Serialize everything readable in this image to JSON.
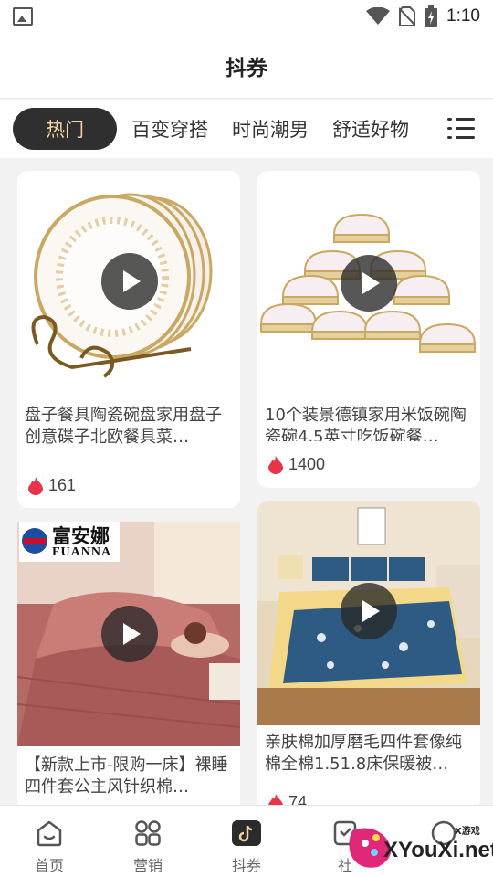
{
  "status_bar": {
    "time": "1:10",
    "icons": [
      "gallery-icon",
      "wifi-icon",
      "no-sim-icon",
      "battery-charging-icon"
    ]
  },
  "header": {
    "title": "抖券"
  },
  "tabs": {
    "items": [
      {
        "label": "热门",
        "active": true
      },
      {
        "label": "百变穿搭",
        "active": false
      },
      {
        "label": "时尚潮男",
        "active": false
      },
      {
        "label": "舒适好物",
        "active": false
      }
    ],
    "menu_icon": "list-menu-icon"
  },
  "feed": {
    "cards": [
      {
        "title": "盘子餐具陶瓷碗盘家用盘子创意碟子北欧餐具菜…",
        "likes": "161"
      },
      {
        "title": "10个装景德镇家用米饭碗陶瓷碗4.5英寸吃饭碗餐…",
        "likes": "1400"
      },
      {
        "title": "【新款上市-限购一床】裸睡四件套公主风针织棉…",
        "likes": "",
        "brand_text": "富安娜",
        "brand_en": "FUANNA"
      },
      {
        "title": "亲肤棉加厚磨毛四件套像纯棉全棉1.51.8床保暖被…",
        "likes": "74"
      }
    ]
  },
  "bottom_nav": {
    "items": [
      {
        "label": "首页",
        "icon": "home-icon",
        "active": false
      },
      {
        "label": "营销",
        "icon": "apps-grid-icon",
        "active": false
      },
      {
        "label": "抖券",
        "icon": "tiktok-icon",
        "active": true
      },
      {
        "label": "社",
        "icon": "community-icon",
        "active": false
      }
    ]
  },
  "watermark": {
    "text": "XYouXi.net",
    "small": "X游戏"
  },
  "colors": {
    "active_tab_bg": "#2f2f2f",
    "active_tab_text": "#f3d3a1",
    "flame": "#e8344a"
  }
}
